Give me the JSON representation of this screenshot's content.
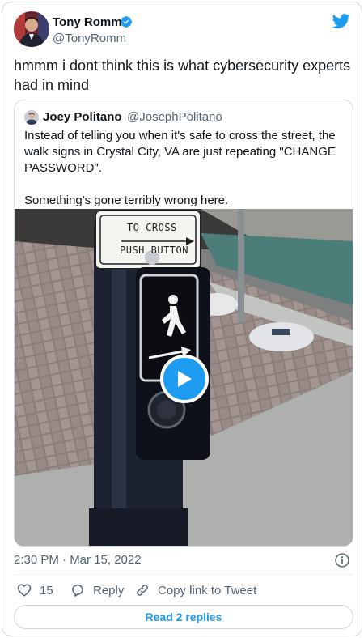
{
  "author": {
    "name": "Tony Romm",
    "handle": "@TonyRomm",
    "verified": true
  },
  "tweet_text": "hmmm i dont think this is what cybersecurity experts had in mind",
  "quoted_tweet": {
    "name": "Joey Politano",
    "handle": "@JosephPolitano",
    "text_paragraph_1": "Instead of telling you when it's safe to cross the street, the walk signs in Crystal City, VA are just repeating \"CHANGE PASSWORD\".",
    "text_paragraph_2": "Something's gone terribly wrong here.",
    "media": {
      "sign_line_1": "TO CROSS",
      "sign_line_2": "PUSH BUTTON",
      "type": "video"
    }
  },
  "timestamp": "2:30 PM · Mar 15, 2022",
  "actions": {
    "like_count": "15",
    "reply_label": "Reply",
    "copy_label": "Copy link to Tweet"
  },
  "read_replies_label": "Read 2 replies",
  "colors": {
    "accent": "#1d9bf0",
    "text": "#0f1419",
    "secondary": "#536471",
    "border": "#cfd9de"
  },
  "icons": [
    "verified-badge-icon",
    "twitter-bird-icon",
    "play-icon",
    "info-icon",
    "heart-icon",
    "reply-icon",
    "link-icon"
  ]
}
